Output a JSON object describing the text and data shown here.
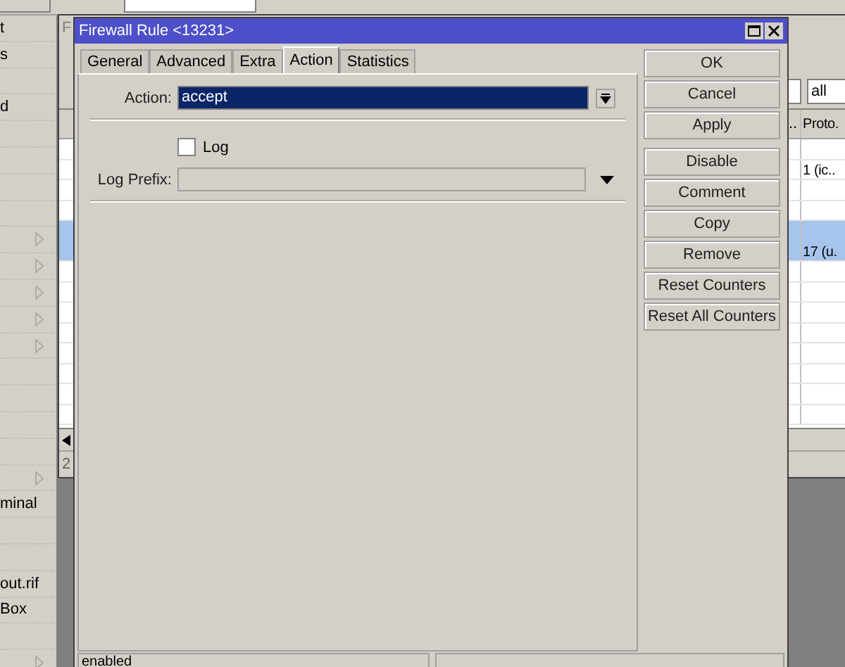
{
  "sidebar": {
    "items": [
      {
        "label": "t",
        "submenu": false
      },
      {
        "label": "s",
        "submenu": false
      },
      {
        "submenu": false
      },
      {
        "label": "d",
        "submenu": false
      },
      {
        "submenu": false
      },
      {
        "submenu": false
      },
      {
        "submenu": false
      },
      {
        "submenu": false
      },
      {
        "submenu": true
      },
      {
        "submenu": true
      },
      {
        "submenu": true
      },
      {
        "submenu": true
      },
      {
        "submenu": true
      },
      {
        "submenu": false
      },
      {
        "submenu": false
      },
      {
        "submenu": false
      },
      {
        "submenu": false
      },
      {
        "submenu": true
      },
      {
        "label": "minal",
        "submenu": false
      },
      {
        "submenu": false
      },
      {
        "submenu": false
      },
      {
        "label": "out.rif",
        "submenu": false
      },
      {
        "label": "Box",
        "submenu": false
      },
      {
        "submenu": false
      },
      {
        "submenu": true
      }
    ]
  },
  "list_window": {
    "title": "F",
    "filter_value": "all",
    "columns": [
      "..",
      "Proto."
    ],
    "rows": [
      {
        "selected": false
      },
      {
        "protocol": "1 (ic..",
        "selected": false
      },
      {
        "selected": false
      },
      {
        "selected": false
      },
      {
        "protocol": "17 (u.",
        "selected": true
      },
      {
        "selected": false
      },
      {
        "selected": false
      },
      {
        "selected": false
      },
      {
        "selected": false
      },
      {
        "selected": false
      },
      {
        "selected": false
      },
      {
        "selected": false
      },
      {
        "selected": false
      }
    ],
    "status": "2"
  },
  "dialog": {
    "title": "Firewall Rule <13231>",
    "tabs": [
      {
        "label": "General",
        "selected": false
      },
      {
        "label": "Advanced",
        "selected": false
      },
      {
        "label": "Extra",
        "selected": false
      },
      {
        "label": "Action",
        "selected": true
      },
      {
        "label": "Statistics",
        "selected": false
      }
    ],
    "action": {
      "label": "Action:",
      "value": "accept"
    },
    "log": {
      "label": "Log",
      "checked": false
    },
    "log_prefix": {
      "label": "Log Prefix:"
    },
    "dialog_buttons": [
      "OK",
      "Cancel",
      "Apply"
    ],
    "rule_buttons": [
      "Disable",
      "Comment",
      "Copy",
      "Remove",
      "Reset Counters",
      "Reset All Counters"
    ],
    "status": "enabled"
  }
}
